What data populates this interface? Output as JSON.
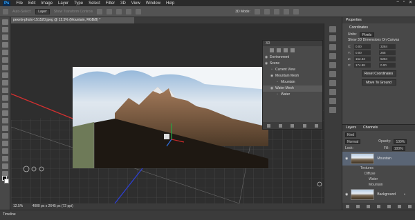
{
  "app": {
    "logo": "Ps"
  },
  "menu": [
    "File",
    "Edit",
    "Image",
    "Layer",
    "Type",
    "Select",
    "Filter",
    "3D",
    "View",
    "Window",
    "Help"
  ],
  "options": {
    "auto_select": "Auto-Select:",
    "auto_select_value": "Layer",
    "transform": "Show Transform Controls",
    "mode3d": "3D Mode:"
  },
  "document_tab": "pexels-photo-151520.jpeg @ 12.5% (Mountain, RGB/8) *",
  "status": {
    "zoom": "12.5%",
    "doc": "4000 px x 2645 px (72 ppi)"
  },
  "timeline": "Timeline",
  "scene_panel": {
    "title": "3D",
    "items": [
      {
        "label": "Environment",
        "indent": 0,
        "selected": false
      },
      {
        "label": "Scene",
        "indent": 0,
        "selected": false
      },
      {
        "label": "Current View",
        "indent": 1,
        "selected": false
      },
      {
        "label": "Mountain Mesh",
        "indent": 1,
        "selected": false
      },
      {
        "label": "Mountain",
        "indent": 2,
        "selected": false
      },
      {
        "label": "Water Mesh",
        "indent": 1,
        "selected": true
      },
      {
        "label": "Water",
        "indent": 2,
        "selected": false
      }
    ]
  },
  "properties": {
    "tab": "Properties",
    "section": "Coordinates",
    "units_label": "Units:",
    "units_value": "Pixels",
    "show_dims": "Show 3D Dimensions On Canvas",
    "coords": [
      {
        "axis": "X:",
        "a": "0.00",
        "b": "3284"
      },
      {
        "axis": "Y:",
        "a": "0.00",
        "b": "265"
      },
      {
        "axis": "Z:",
        "a": "152.33",
        "b": "5284"
      },
      {
        "axis": "X:",
        "a": "174.88",
        "b": "0.00"
      }
    ],
    "btn_reset": "Reset Coordinates",
    "btn_ground": "Move To Ground"
  },
  "layers": {
    "tabs": [
      "Layers",
      "Channels"
    ],
    "kind": "Kind",
    "blend": "Normal",
    "opacity_label": "Opacity:",
    "opacity": "100%",
    "lock_label": "Lock:",
    "fill_label": "Fill:",
    "fill": "100%",
    "layer1": "Mountain",
    "sub": [
      "Textures",
      "Diffuse",
      "Water",
      "Mountain"
    ],
    "layer2": "Background"
  }
}
